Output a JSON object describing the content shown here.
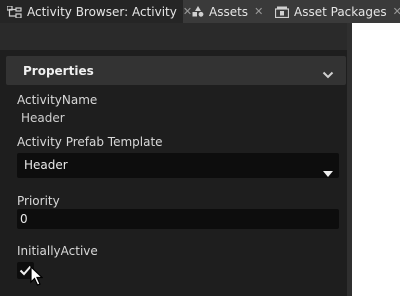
{
  "tabs": [
    {
      "label": "Activity Browser: Activity",
      "icon": "activity-tree-icon",
      "active": true
    },
    {
      "label": "Assets",
      "icon": "assets-icon",
      "active": false
    },
    {
      "label": "Asset Packages",
      "icon": "asset-packages-icon",
      "active": false
    }
  ],
  "tab_close_glyph": "✕",
  "properties": {
    "title": "Properties",
    "activity_name_label": "ActivityName",
    "activity_name_value": "Header",
    "prefab_template_label": "Activity Prefab Template",
    "prefab_template_value": "Header",
    "priority_label": "Priority",
    "priority_value": "0",
    "initially_active_label": "InitiallyActive",
    "initially_active_checked": true
  },
  "colors": {
    "tab_bar": "#3a3a3a",
    "active_tab": "#252525",
    "panel_bg": "#1e1e1e",
    "panel_header": "#333333",
    "field_bg": "#0d0d0d",
    "text": "#d9d9d9"
  }
}
